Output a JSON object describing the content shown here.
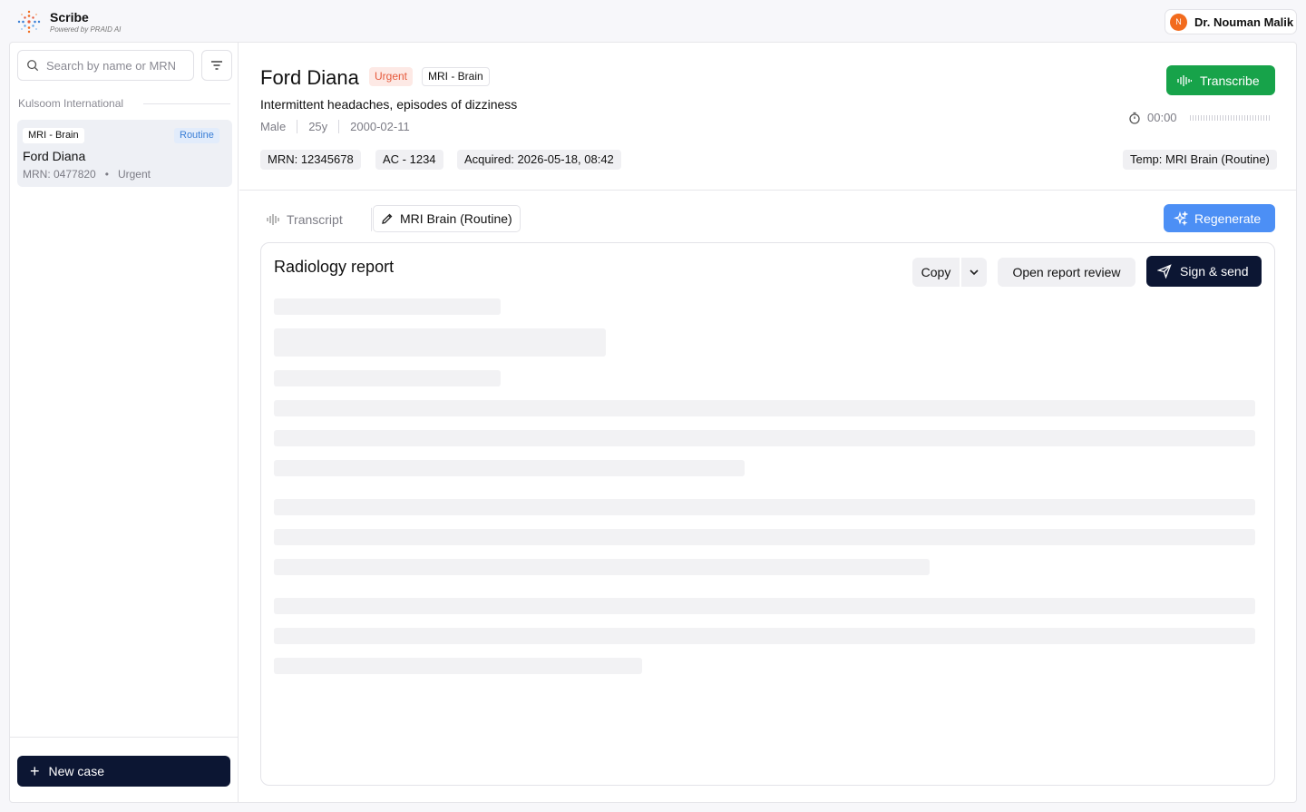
{
  "app": {
    "name": "Scribe",
    "tagline": "Powered by PRAID AI"
  },
  "user": {
    "initial": "N",
    "name": "Dr. Nouman Malik"
  },
  "sidebar": {
    "search_placeholder": "Search by name or MRN",
    "group_label": "Kulsoom International",
    "cases": [
      {
        "modality": "MRI - Brain",
        "priority_tag": "Routine",
        "name": "Ford Diana",
        "mrn": "MRN: 0477820",
        "priority": "Urgent"
      }
    ],
    "new_case_label": "New case"
  },
  "patient": {
    "name": "Ford Diana",
    "priority": "Urgent",
    "modality": "MRI - Brain",
    "complaint": "Intermittent headaches, episodes of dizziness",
    "sex": "Male",
    "age": "25y",
    "dob": "2000-02-11",
    "mrn": "MRN: 12345678",
    "accession": "AC - 1234",
    "acquired": "Acquired: 2026-05-18, 08:42",
    "template": "Temp: MRI Brain (Routine)"
  },
  "recorder": {
    "transcribe_label": "Transcribe",
    "timer": "00:00"
  },
  "tabs": {
    "transcript": "Transcript",
    "template": "MRI Brain (Routine)"
  },
  "actions": {
    "regenerate": "Regenerate",
    "copy": "Copy",
    "open_review": "Open report review",
    "sign_send": "Sign & send"
  },
  "report": {
    "title": "Radiology report"
  },
  "colors": {
    "primary_dark": "#0c1633",
    "transcribe_green": "#17a34a",
    "regenerate_blue": "#4c8ff5",
    "urgent": "#e65a3c",
    "routine": "#3b7fd6"
  }
}
